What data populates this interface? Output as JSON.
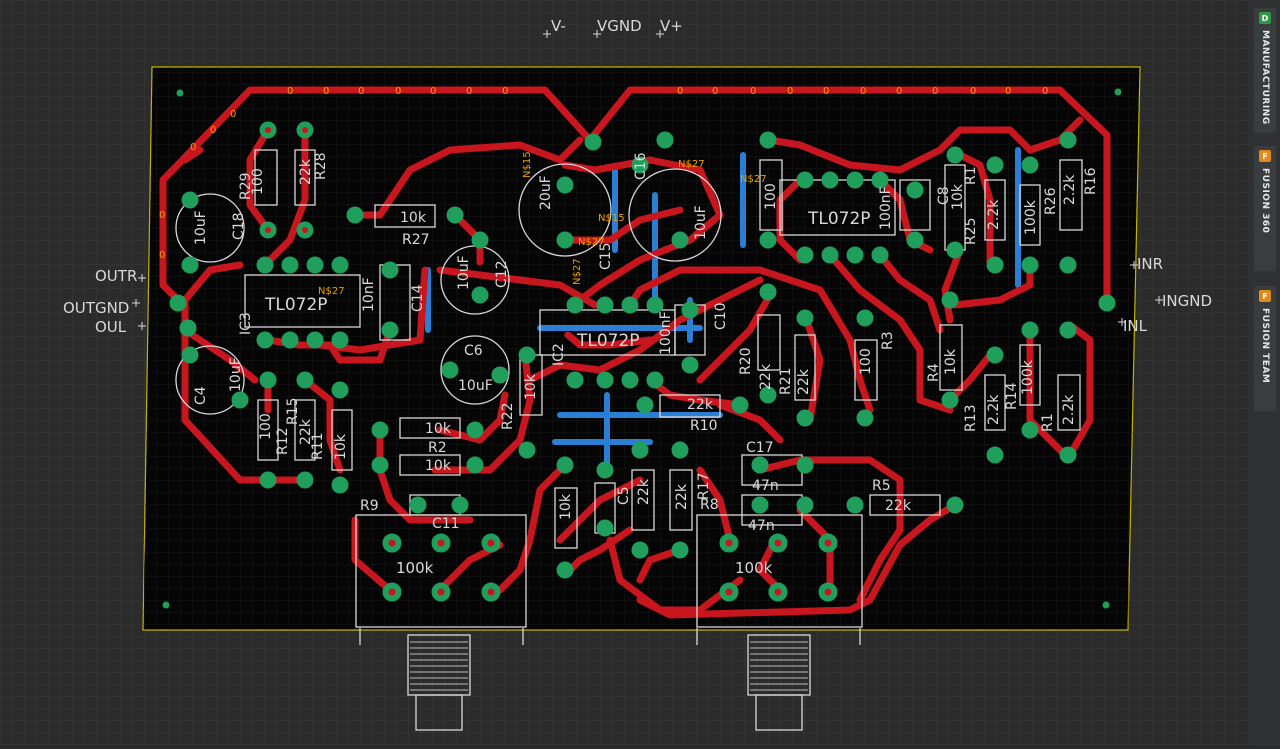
{
  "colors": {
    "background": "#2b2b2b",
    "grid": "#3a3a3a",
    "board": "#050505",
    "board_edge": "#c8b400",
    "top_copper": "#c8161e",
    "bottom_copper": "#2a7fd4",
    "pad": "#1f9e5c",
    "silk": "#d9d9d9",
    "net_label": "#e8a000",
    "manufacturing_badge": "#2e9a48",
    "fusion_badge": "#e08a1e"
  },
  "side_panel": {
    "tabs": [
      {
        "label": "MANUFACTURING",
        "icon": "manufacturing-icon",
        "badge": "D"
      },
      {
        "label": "FUSION 360",
        "icon": "fusion-360-icon",
        "badge": "F"
      },
      {
        "label": "FUSION TEAM",
        "icon": "fusion-team-icon",
        "badge": "F"
      }
    ]
  },
  "supply_labels": {
    "v_minus": "V-",
    "vgnd": "VGND",
    "v_plus": "V+"
  },
  "io_labels": {
    "outr": "OUTR",
    "outgnd": "OUTGND",
    "oul": "OUL",
    "inr": "INR",
    "ingnd": "INGND",
    "inl": "INL"
  },
  "ic_labels": {
    "tl072p": "TL072P",
    "ic3": "IC3",
    "ic2": "IC2"
  },
  "net_labels": {
    "n15": "N$15",
    "n27": "N$27"
  },
  "components": {
    "r27": "R27",
    "v_10k": "10k",
    "r28": "R28",
    "v_22k": "22k",
    "r29": "R29",
    "v_100": "100",
    "c18": "C18",
    "v_10uf": "10uF",
    "c16": "C16",
    "c15": "C15",
    "c12": "C12",
    "c14": "C14",
    "c6": "C6",
    "c4": "C4",
    "c8": "C8",
    "c10": "C10",
    "c11": "C11",
    "c17": "C17",
    "c5": "C5",
    "r16": "R16",
    "r26": "R26",
    "r25": "R25",
    "r1": "R1",
    "r13": "R13",
    "r14": "R14",
    "r4": "R4",
    "r3": "R3",
    "r10": "R10",
    "r11": "R11",
    "r12": "R12",
    "r15": "R15",
    "r22": "R22",
    "r2": "R2",
    "r5": "R5",
    "r8": "R8",
    "r9": "R9",
    "r17": "R17",
    "r20": "R20",
    "r21": "R21",
    "v_2_2k": "2.2k",
    "v_100k": "100k",
    "v_100nf": "100nF",
    "v_10nf": "10nF",
    "v_47n": "47n",
    "v_20uf": "20uF",
    "v_10uf_b": "10uF"
  },
  "potentiometers": [
    {
      "label": "100k"
    },
    {
      "label": "100k"
    }
  ]
}
